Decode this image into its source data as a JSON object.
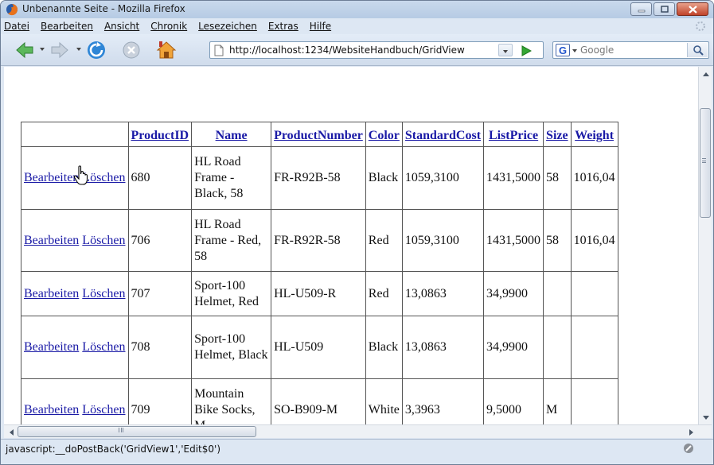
{
  "window": {
    "title": "Unbenannte Seite - Mozilla Firefox"
  },
  "menubar": {
    "items": [
      "Datei",
      "Bearbeiten",
      "Ansicht",
      "Chronik",
      "Lesezeichen",
      "Extras",
      "Hilfe"
    ]
  },
  "toolbar": {
    "url": "http://localhost:1234/WebsiteHandbuch/GridView",
    "search_placeholder": "Google",
    "search_engine_icon": "G"
  },
  "grid": {
    "headers": [
      "",
      "ProductID",
      "Name",
      "ProductNumber",
      "Color",
      "StandardCost",
      "ListPrice",
      "Size",
      "Weight"
    ],
    "edit_label": "Bearbeiten",
    "delete_label": "Löschen",
    "rows": [
      {
        "id": "680",
        "name": "HL Road Frame - Black, 58",
        "number": "FR-R92B-58",
        "color": "Black",
        "cost": "1059,3100",
        "price": "1431,5000",
        "size": "58",
        "weight": "1016,04"
      },
      {
        "id": "706",
        "name": "HL Road Frame - Red, 58",
        "number": "FR-R92R-58",
        "color": "Red",
        "cost": "1059,3100",
        "price": "1431,5000",
        "size": "58",
        "weight": "1016,04"
      },
      {
        "id": "707",
        "name": "Sport-100 Helmet, Red",
        "number": "HL-U509-R",
        "color": "Red",
        "cost": "13,0863",
        "price": "34,9900",
        "size": "",
        "weight": ""
      },
      {
        "id": "708",
        "name": "Sport-100 Helmet, Black",
        "number": "HL-U509",
        "color": "Black",
        "cost": "13,0863",
        "price": "34,9900",
        "size": "",
        "weight": ""
      },
      {
        "id": "709",
        "name": "Mountain Bike Socks, M",
        "number": "SO-B909-M",
        "color": "White",
        "cost": "3,3963",
        "price": "9,5000",
        "size": "M",
        "weight": ""
      }
    ]
  },
  "statusbar": {
    "text": "javascript:__doPostBack('GridView1','Edit$0')"
  },
  "colors": {
    "link": "#1a1aa6",
    "chrome": "#dde7f3"
  },
  "icons": [
    "firefox-icon",
    "back-icon",
    "forward-icon",
    "reload-icon",
    "stop-icon",
    "home-icon",
    "page-icon",
    "go-icon",
    "search-icon",
    "hand-pointer-icon"
  ]
}
